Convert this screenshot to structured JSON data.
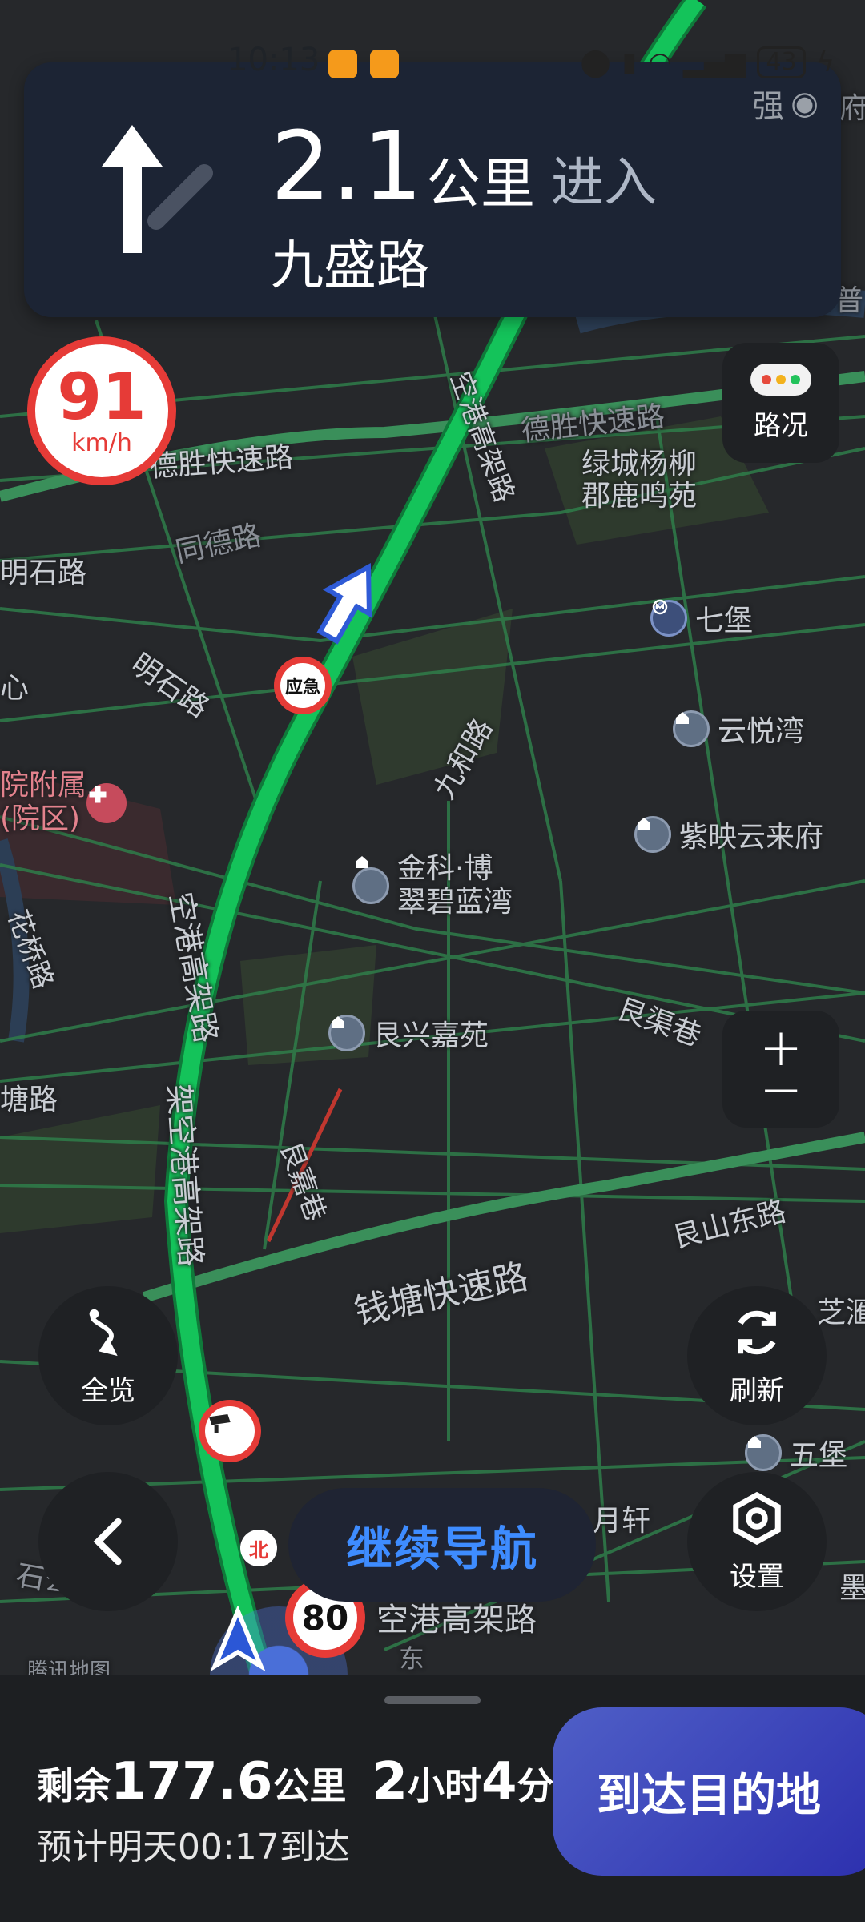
{
  "status_bar": {
    "time": "10:13",
    "battery": "43"
  },
  "banner": {
    "distance": "2.1",
    "unit": "公里",
    "action": "进入",
    "road": "九盛路",
    "signal_text": "强"
  },
  "speed": {
    "value": "91",
    "unit": "km/h"
  },
  "buttons": {
    "traffic": "路况",
    "zoom_in": "+",
    "zoom_out": "−",
    "overview": "全览",
    "refresh": "刷新",
    "settings": "设置",
    "continue": "继续导航",
    "arrive": "到达目的地"
  },
  "markers": {
    "emergency": "应急",
    "north": "北",
    "speed_limit": "80"
  },
  "map_labels": {
    "desheng_left": "德胜快速路",
    "desheng_right": "德胜快速路",
    "tongde": "同德路",
    "mingshi_left": "明石路",
    "mingshi_diag": "明石路",
    "xin": "心",
    "hospital": "院附属\n(院区)",
    "jiuhe": "九和路",
    "konggang_upper": "空港高架路",
    "konggang_lower": "空港高架路",
    "konggang_branch": "架空港高架路",
    "genqu": "艮渠巷",
    "genjia": "艮嘉巷",
    "tang": "塘路",
    "qiantang": "钱塘快速路",
    "genshan": "艮山东路",
    "zhi": "芝滙",
    "shigong": "石公湖路",
    "yuexuan": "月轩",
    "huaqiao": "花桥路",
    "konggang_bottom": "空港高架路",
    "dong": "东",
    "tencent": "腾讯地图",
    "mo": "墨",
    "pu": "普",
    "fu": "府"
  },
  "pois": {
    "lvcheng": "绿城杨柳\n郡鹿鸣苑",
    "qibao": "七堡",
    "yunyuewan": "云悦湾",
    "ziying": "紫映云来府",
    "jinke": "金科·博\n翠碧蓝湾",
    "genxing": "艮兴嘉苑",
    "wubao": "五堡"
  },
  "panel": {
    "remain_prefix": "剩余",
    "remain_distance": "177.6",
    "remain_unit": "公里",
    "hours": "2",
    "hours_unit": "小时",
    "minutes": "4",
    "minutes_unit": "分",
    "eta": "预计明天00:17到达"
  },
  "colors": {
    "route": "#14c35a",
    "banner_bg": "#1c2434",
    "accent_blue": "#3e8cff",
    "speed_red": "#e63b37"
  }
}
